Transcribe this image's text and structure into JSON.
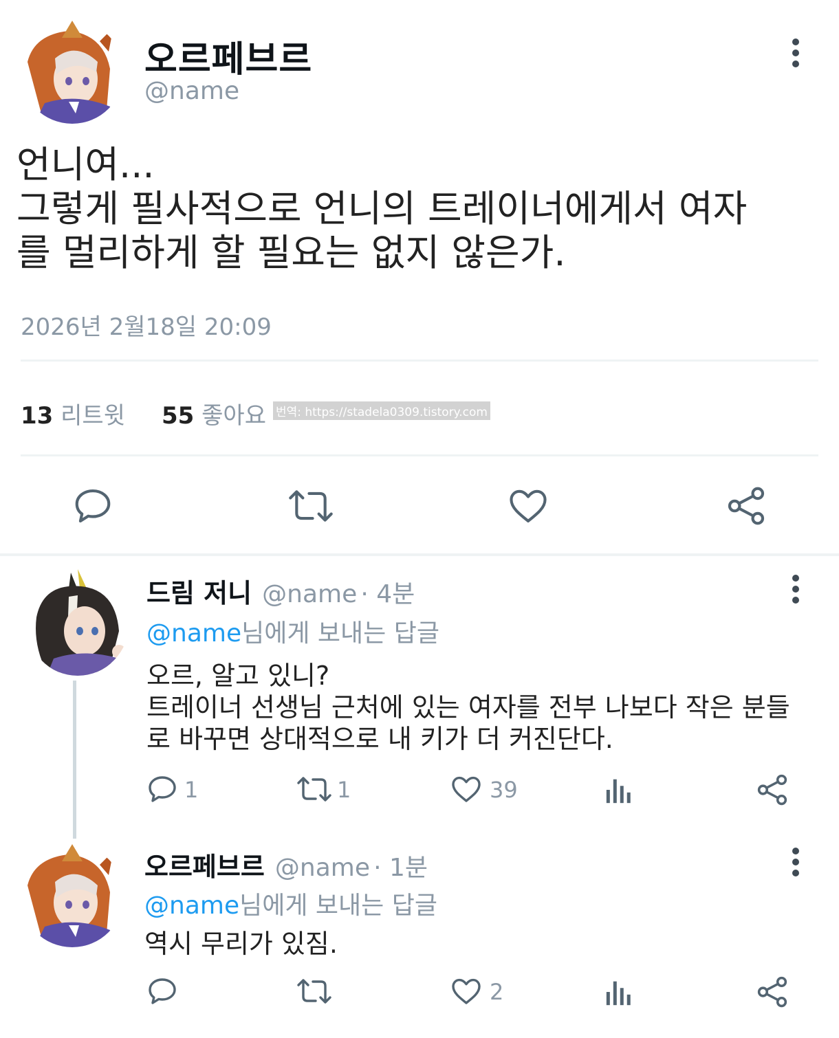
{
  "main_tweet": {
    "display_name": "오르페브르",
    "handle": "@name",
    "avatar": "orfevre-avatar",
    "text": "언니여...\n그렇게 필사적으로 언니의 트레이너에게서 여자\n를 멀리하게 할 필요는 없지 않은가.",
    "timestamp": "2026년 2월18일 20:09",
    "retweet_count": "13",
    "retweet_label": "리트윗",
    "like_count": "55",
    "like_label": "좋아요",
    "watermark": "번역: https://stadela0309.tistory.com",
    "actions": [
      "reply-icon",
      "retweet-icon",
      "like-icon",
      "share-icon"
    ]
  },
  "replies": [
    {
      "display_name": "드림 저니",
      "handle": "@name",
      "time": "· 4분",
      "avatar": "dream-journey-avatar",
      "reply_to_mention": "@name",
      "reply_to_suffix": "님에게 보내는 답글",
      "text": "오르, 알고 있니?\n트레이너 선생님 근처에 있는 여자를 전부 나보다 작은 분들\n로 바꾸면 상대적으로 내 키가 더 커진단다.",
      "reply_count": "1",
      "retweet_count": "1",
      "like_count": "39"
    },
    {
      "display_name": "오르페브르",
      "handle": "@name",
      "time": "· 1분",
      "avatar": "orfevre-avatar",
      "reply_to_mention": "@name",
      "reply_to_suffix": "님에게 보내는 답글",
      "text": "역시 무리가 있짐.",
      "reply_count": "",
      "retweet_count": "",
      "like_count": "2"
    }
  ],
  "colors": {
    "text": "#0f1419",
    "muted": "#8b98a5",
    "mention": "#1d9bf0",
    "icon": "#536471",
    "divider": "#eff3f4"
  }
}
